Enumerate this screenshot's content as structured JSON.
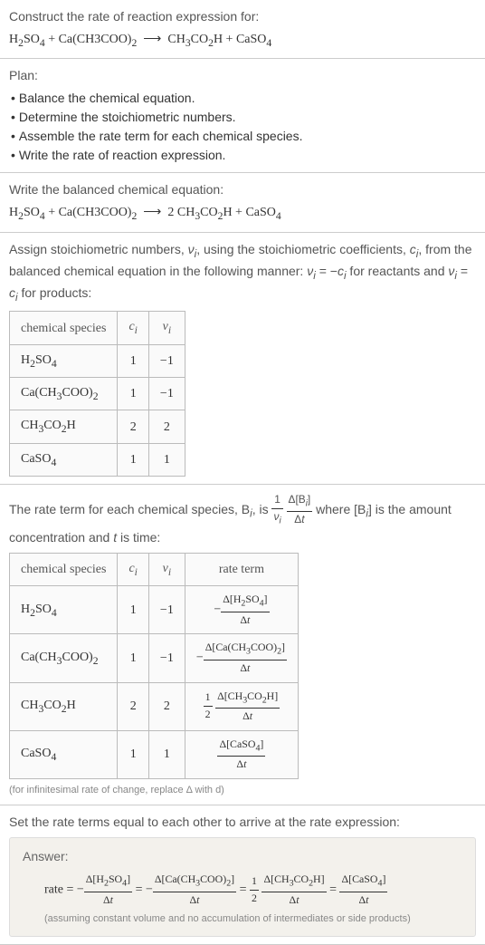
{
  "header": {
    "prompt": "Construct the rate of reaction expression for:",
    "equation_html": "H<sub>2</sub>SO<sub>4</sub> + Ca(CH3COO)<sub>2</sub> &nbsp;⟶&nbsp; CH<sub>3</sub>CO<sub>2</sub>H + CaSO<sub>4</sub>"
  },
  "plan": {
    "title": "Plan:",
    "items": [
      "Balance the chemical equation.",
      "Determine the stoichiometric numbers.",
      "Assemble the rate term for each chemical species.",
      "Write the rate of reaction expression."
    ]
  },
  "balanced": {
    "prompt": "Write the balanced chemical equation:",
    "equation_html": "H<sub>2</sub>SO<sub>4</sub> + Ca(CH3COO)<sub>2</sub> &nbsp;⟶&nbsp; 2 CH<sub>3</sub>CO<sub>2</sub>H + CaSO<sub>4</sub>"
  },
  "stoich": {
    "intro_html": "Assign stoichiometric numbers, <i>ν<sub>i</sub></i>, using the stoichiometric coefficients, <i>c<sub>i</sub></i>, from the balanced chemical equation in the following manner: <i>ν<sub>i</sub></i> = −<i>c<sub>i</sub></i> for reactants and <i>ν<sub>i</sub></i> = <i>c<sub>i</sub></i> for products:",
    "headers": [
      "chemical species",
      "c_i",
      "ν_i"
    ],
    "rows": [
      {
        "species_html": "H<sub>2</sub>SO<sub>4</sub>",
        "c": "1",
        "v": "−1"
      },
      {
        "species_html": "Ca(CH<sub>3</sub>COO)<sub>2</sub>",
        "c": "1",
        "v": "−1"
      },
      {
        "species_html": "CH<sub>3</sub>CO<sub>2</sub>H",
        "c": "2",
        "v": "2"
      },
      {
        "species_html": "CaSO<sub>4</sub>",
        "c": "1",
        "v": "1"
      }
    ]
  },
  "rateterm": {
    "intro_html": "The rate term for each chemical species, B<sub><i>i</i></sub>, is <span class='frac'><span class='num'>1</span><span class='den'><i>ν<sub>i</sub></i></span></span> <span class='frac'><span class='num'>Δ[B<sub><i>i</i></sub>]</span><span class='den'>Δ<i>t</i></span></span> where [B<sub><i>i</i></sub>] is the amount concentration and <i>t</i> is time:",
    "headers": [
      "chemical species",
      "c_i",
      "ν_i",
      "rate term"
    ],
    "rows": [
      {
        "species_html": "H<sub>2</sub>SO<sub>4</sub>",
        "c": "1",
        "v": "−1",
        "rate_html": "−<span class='frac'><span class='num'>Δ[H<sub>2</sub>SO<sub>4</sub>]</span><span class='den'>Δ<i>t</i></span></span>"
      },
      {
        "species_html": "Ca(CH<sub>3</sub>COO)<sub>2</sub>",
        "c": "1",
        "v": "−1",
        "rate_html": "−<span class='frac'><span class='num'>Δ[Ca(CH<sub>3</sub>COO)<sub>2</sub>]</span><span class='den'>Δ<i>t</i></span></span>"
      },
      {
        "species_html": "CH<sub>3</sub>CO<sub>2</sub>H",
        "c": "2",
        "v": "2",
        "rate_html": "<span class='frac'><span class='num'>1</span><span class='den'>2</span></span> <span class='frac'><span class='num'>Δ[CH<sub>3</sub>CO<sub>2</sub>H]</span><span class='den'>Δ<i>t</i></span></span>"
      },
      {
        "species_html": "CaSO<sub>4</sub>",
        "c": "1",
        "v": "1",
        "rate_html": "<span class='frac'><span class='num'>Δ[CaSO<sub>4</sub>]</span><span class='den'>Δ<i>t</i></span></span>"
      }
    ],
    "note": "(for infinitesimal rate of change, replace Δ with d)"
  },
  "final": {
    "prompt": "Set the rate terms equal to each other to arrive at the rate expression:",
    "answer_label": "Answer:",
    "expression_html": "rate = −<span class='frac'><span class='num'>Δ[H<sub>2</sub>SO<sub>4</sub>]</span><span class='den'>Δ<i>t</i></span></span> = −<span class='frac'><span class='num'>Δ[Ca(CH<sub>3</sub>COO)<sub>2</sub>]</span><span class='den'>Δ<i>t</i></span></span> = <span class='frac'><span class='num'>1</span><span class='den'>2</span></span> <span class='frac'><span class='num'>Δ[CH<sub>3</sub>CO<sub>2</sub>H]</span><span class='den'>Δ<i>t</i></span></span> = <span class='frac'><span class='num'>Δ[CaSO<sub>4</sub>]</span><span class='den'>Δ<i>t</i></span></span>",
    "assumption": "(assuming constant volume and no accumulation of intermediates or side products)"
  }
}
